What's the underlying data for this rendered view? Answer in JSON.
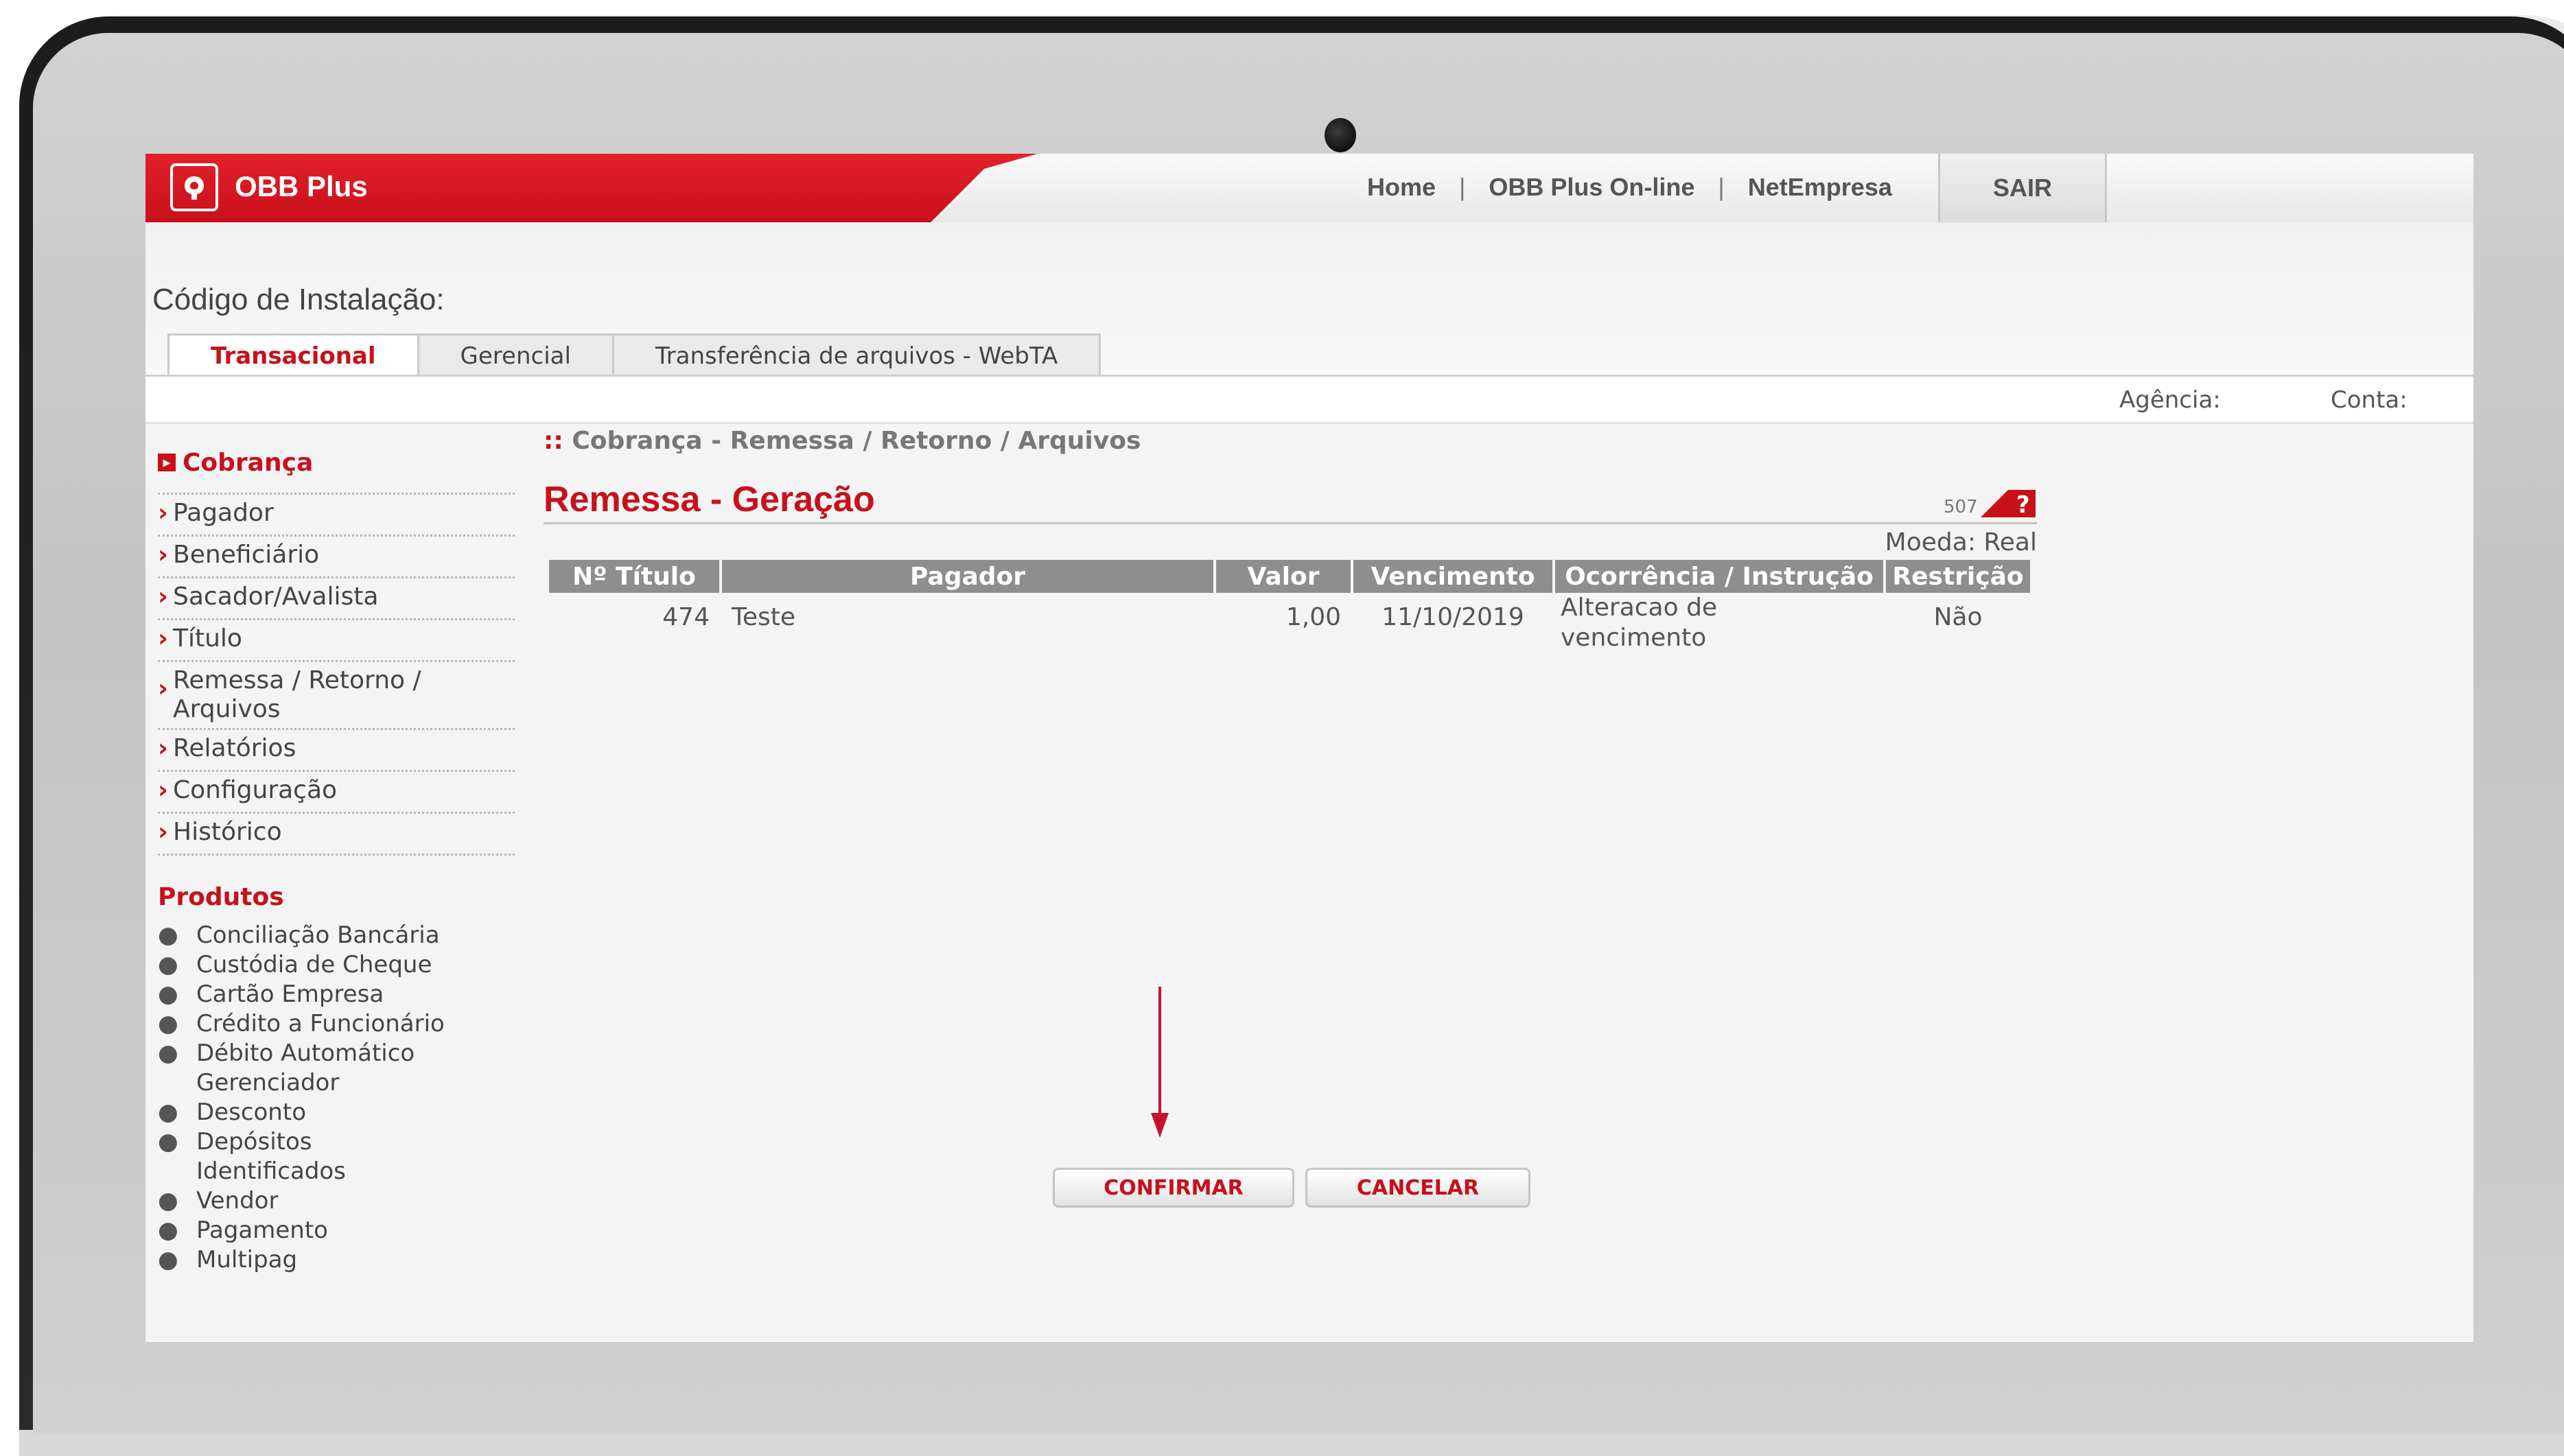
{
  "brand": "OBB Plus",
  "topnav": {
    "home": "Home",
    "online": "OBB Plus On-line",
    "netempresa": "NetEmpresa",
    "sep": "|",
    "sair": "SAIR"
  },
  "install_label": "Código de Instalação:",
  "tabs": [
    {
      "label": "Transacional",
      "active": true
    },
    {
      "label": "Gerencial",
      "active": false
    },
    {
      "label": "Transferência de arquivos - WebTA",
      "active": false
    }
  ],
  "account": {
    "agencia_label": "Agência:",
    "conta_label": "Conta:"
  },
  "sidebar": {
    "section_title": "Cobrança",
    "items": [
      {
        "label": "Pagador"
      },
      {
        "label": "Beneficiário"
      },
      {
        "label": "Sacador/Avalista"
      },
      {
        "label": "Título"
      },
      {
        "label": "Remessa / Retorno / Arquivos"
      },
      {
        "label": "Relatórios"
      },
      {
        "label": "Configuração"
      },
      {
        "label": "Histórico"
      }
    ],
    "products_title": "Produtos",
    "products": [
      "Conciliação Bancária",
      "Custódia de Cheque",
      "Cartão Empresa",
      "Crédito a Funcionário",
      "Débito Automático Gerenciador",
      "Desconto",
      "Depósitos Identificados",
      "Vendor",
      "Pagamento",
      "Multipag"
    ]
  },
  "breadcrumb": "Cobrança - Remessa / Retorno / Arquivos",
  "page_title": "Remessa - Geração",
  "page_code": "507",
  "currency": "Moeda: Real",
  "table": {
    "headers": [
      "Nº Título",
      "Pagador",
      "Valor",
      "Vencimento",
      "Ocorrência / Instrução",
      "Restrição"
    ],
    "rows": [
      {
        "numero": "474",
        "pagador": "Teste",
        "valor": "1,00",
        "vencimento": "11/10/2019",
        "ocorrencia": "Alteracao de vencimento",
        "restricao": "Não"
      }
    ]
  },
  "buttons": {
    "confirm": "CONFIRMAR",
    "cancel": "CANCELAR"
  },
  "colors": {
    "brand_red": "#c8101b",
    "arrow": "#c8102e",
    "header_gray": "#8e8e8e"
  },
  "icons": {
    "logo": "obb-logo-icon",
    "help": "help-icon",
    "section": "bullet-square-icon",
    "menu": "chevron-right-icon"
  }
}
